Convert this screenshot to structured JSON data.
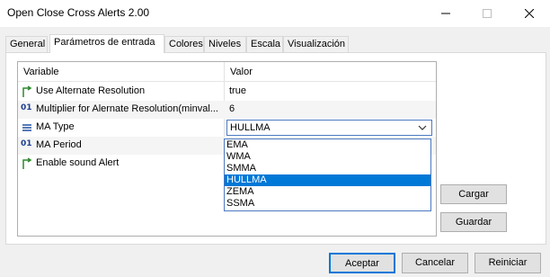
{
  "window": {
    "title": "Open Close Cross Alerts 2.00"
  },
  "tabs": [
    {
      "label": "General"
    },
    {
      "label": "Parámetros de entrada"
    },
    {
      "label": "Colores"
    },
    {
      "label": "Niveles"
    },
    {
      "label": "Escala"
    },
    {
      "label": "Visualización"
    }
  ],
  "table": {
    "headers": {
      "variable": "Variable",
      "value": "Valor"
    },
    "rows": [
      {
        "icon": "arrow-icon",
        "name": "Use Alternate Resolution",
        "value": "true"
      },
      {
        "icon": "number-icon",
        "name": "Multiplier for Alernate Resolution(minval...",
        "value": "6"
      },
      {
        "icon": "list-icon",
        "name": "MA Type",
        "value": "HULLMA"
      },
      {
        "icon": "number-icon",
        "name": "MA Period",
        "value": ""
      },
      {
        "icon": "arrow-icon",
        "name": "Enable sound Alert",
        "value": ""
      }
    ]
  },
  "dropdown": {
    "selected": "HULLMA",
    "options": [
      "EMA",
      "WMA",
      "SMMA",
      "HULLMA",
      "ZEMA",
      "SSMA"
    ]
  },
  "side_buttons": {
    "load": "Cargar",
    "save": "Guardar"
  },
  "footer": {
    "accept": "Aceptar",
    "cancel": "Cancelar",
    "reset": "Reiniciar"
  },
  "colors": {
    "accent": "#0078d7",
    "selection_text": "#ffffff"
  }
}
